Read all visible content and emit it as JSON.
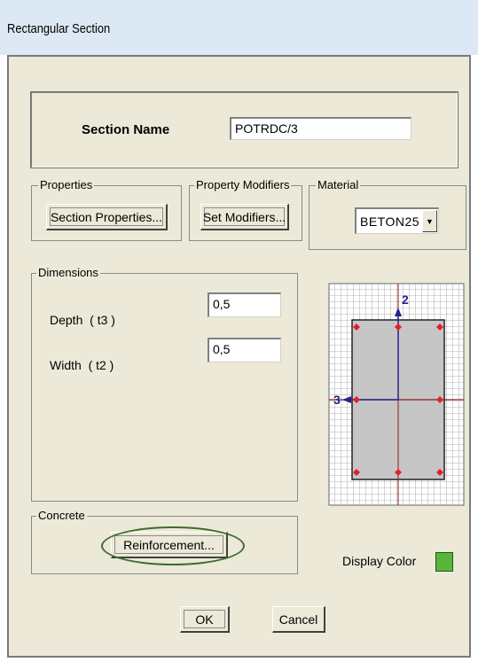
{
  "window": {
    "title": "Rectangular Section"
  },
  "section_name": {
    "label": "Section Name",
    "value": "POTRDC/3"
  },
  "properties": {
    "legend": "Properties",
    "button": "Section Properties..."
  },
  "property_modifiers": {
    "legend": "Property Modifiers",
    "button": "Set Modifiers..."
  },
  "material": {
    "legend": "Material",
    "selected": "BETON25"
  },
  "dimensions": {
    "legend": "Dimensions",
    "depth_label": "Depth  ( t3 )",
    "depth_value": "0,5",
    "width_label": "Width  ( t2 )",
    "width_value": "0,5"
  },
  "preview": {
    "axis_2_label": "2",
    "axis_3_label": "3"
  },
  "concrete": {
    "legend": "Concrete",
    "button": "Reinforcement..."
  },
  "display_color": {
    "label": "Display Color",
    "color": "#58b63f"
  },
  "footer": {
    "ok": "OK",
    "cancel": "Cancel"
  },
  "colors": {
    "rebar": "#e0202a",
    "axis": "#23238c",
    "section_fill": "#c6c6c6",
    "grid": "#9a9a9a"
  }
}
